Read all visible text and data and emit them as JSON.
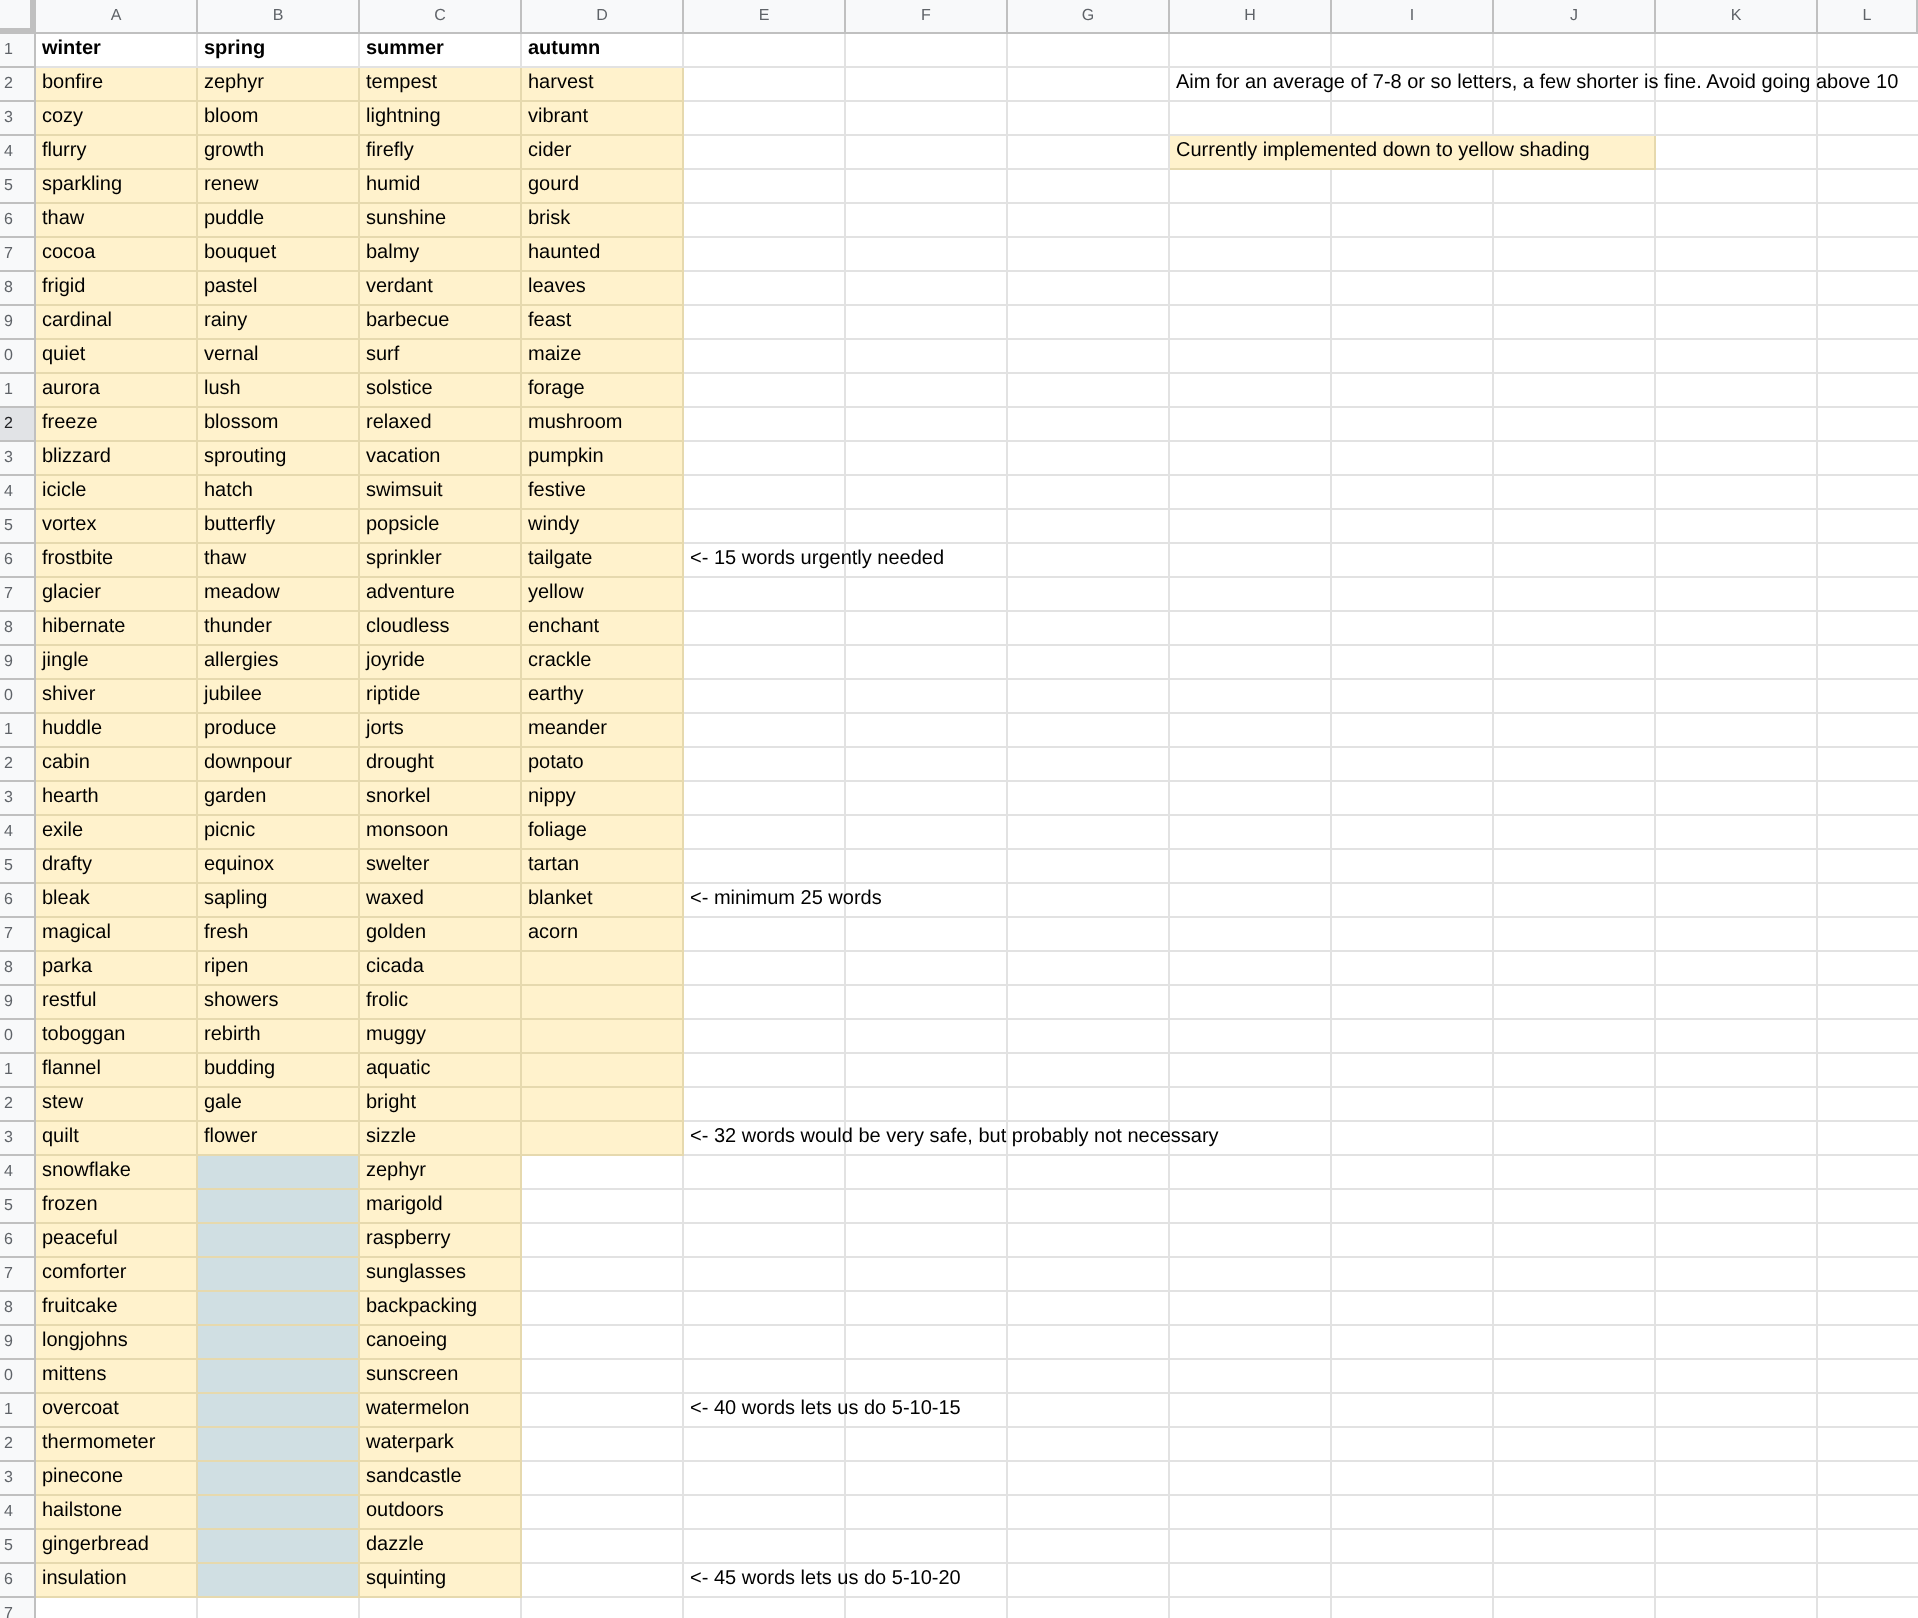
{
  "columns": [
    "A",
    "B",
    "C",
    "D",
    "E",
    "F",
    "G",
    "H",
    "I",
    "J",
    "K",
    "L"
  ],
  "rows": [
    {
      "number": "1",
      "selected": false,
      "kind": "heading",
      "cells": [
        {
          "text": "winter"
        },
        {
          "text": "spring"
        },
        {
          "text": "summer"
        },
        {
          "text": "autumn"
        }
      ]
    },
    {
      "number": "2",
      "selected": false,
      "kind": "words",
      "cells": [
        {
          "text": "bonfire",
          "color": "#fff2cc"
        },
        {
          "text": "zephyr",
          "color": "#fff2cc"
        },
        {
          "text": "tempest",
          "color": "#fff2cc"
        },
        {
          "text": "harvest",
          "color": "#fff2cc"
        }
      ],
      "side_note": {
        "text": "Aim for an average of 7-8 or so letters, a few shorter is fine. Avoid going above 10"
      }
    },
    {
      "number": "3",
      "selected": false,
      "kind": "words",
      "cells": [
        {
          "text": "cozy",
          "color": "#fff2cc"
        },
        {
          "text": "bloom",
          "color": "#fff2cc"
        },
        {
          "text": "lightning",
          "color": "#fff2cc"
        },
        {
          "text": "vibrant",
          "color": "#fff2cc"
        }
      ]
    },
    {
      "number": "4",
      "selected": false,
      "kind": "words",
      "cells": [
        {
          "text": "flurry",
          "color": "#fff2cc"
        },
        {
          "text": "growth",
          "color": "#fff2cc"
        },
        {
          "text": "firefly",
          "color": "#fff2cc"
        },
        {
          "text": "cider",
          "color": "#fff2cc"
        }
      ],
      "side_note": {
        "text": "Currently implemented down to yellow shading",
        "color": "#fff2cc"
      }
    },
    {
      "number": "5",
      "selected": false,
      "kind": "words",
      "cells": [
        {
          "text": "sparkling",
          "color": "#fff2cc"
        },
        {
          "text": "renew",
          "color": "#fff2cc"
        },
        {
          "text": "humid",
          "color": "#fff2cc"
        },
        {
          "text": "gourd",
          "color": "#fff2cc"
        }
      ]
    },
    {
      "number": "6",
      "selected": false,
      "kind": "words",
      "cells": [
        {
          "text": "thaw",
          "color": "#fff2cc"
        },
        {
          "text": "puddle",
          "color": "#fff2cc"
        },
        {
          "text": "sunshine",
          "color": "#fff2cc"
        },
        {
          "text": "brisk",
          "color": "#fff2cc"
        }
      ]
    },
    {
      "number": "7",
      "selected": false,
      "kind": "words",
      "cells": [
        {
          "text": "cocoa",
          "color": "#fff2cc"
        },
        {
          "text": "bouquet",
          "color": "#fff2cc"
        },
        {
          "text": "balmy",
          "color": "#fff2cc"
        },
        {
          "text": "haunted",
          "color": "#fff2cc"
        }
      ]
    },
    {
      "number": "8",
      "selected": false,
      "kind": "words",
      "cells": [
        {
          "text": "frigid",
          "color": "#fff2cc"
        },
        {
          "text": "pastel",
          "color": "#fff2cc"
        },
        {
          "text": "verdant",
          "color": "#fff2cc"
        },
        {
          "text": "leaves",
          "color": "#fff2cc"
        }
      ]
    },
    {
      "number": "9",
      "selected": false,
      "kind": "words",
      "cells": [
        {
          "text": "cardinal",
          "color": "#fff2cc"
        },
        {
          "text": "rainy",
          "color": "#fff2cc"
        },
        {
          "text": "barbecue",
          "color": "#fff2cc"
        },
        {
          "text": "feast",
          "color": "#fff2cc"
        }
      ]
    },
    {
      "number": "0",
      "selected": false,
      "kind": "words",
      "cells": [
        {
          "text": "quiet",
          "color": "#fff2cc"
        },
        {
          "text": "vernal",
          "color": "#fff2cc"
        },
        {
          "text": "surf",
          "color": "#fff2cc"
        },
        {
          "text": "maize",
          "color": "#fff2cc"
        }
      ]
    },
    {
      "number": "1",
      "selected": false,
      "kind": "words",
      "cells": [
        {
          "text": "aurora",
          "color": "#fff2cc"
        },
        {
          "text": "lush",
          "color": "#fff2cc"
        },
        {
          "text": "solstice",
          "color": "#fff2cc"
        },
        {
          "text": "forage",
          "color": "#fff2cc"
        }
      ]
    },
    {
      "number": "2",
      "selected": true,
      "kind": "words",
      "cells": [
        {
          "text": "freeze",
          "color": "#fff2cc"
        },
        {
          "text": "blossom",
          "color": "#fff2cc"
        },
        {
          "text": "relaxed",
          "color": "#fff2cc"
        },
        {
          "text": "mushroom",
          "color": "#fff2cc"
        }
      ]
    },
    {
      "number": "3",
      "selected": false,
      "kind": "words",
      "cells": [
        {
          "text": "blizzard",
          "color": "#fff2cc"
        },
        {
          "text": "sprouting",
          "color": "#fff2cc"
        },
        {
          "text": "vacation",
          "color": "#fff2cc"
        },
        {
          "text": "pumpkin",
          "color": "#fff2cc"
        }
      ]
    },
    {
      "number": "4",
      "selected": false,
      "kind": "words",
      "cells": [
        {
          "text": "icicle",
          "color": "#fff2cc"
        },
        {
          "text": "hatch",
          "color": "#fff2cc"
        },
        {
          "text": "swimsuit",
          "color": "#fff2cc"
        },
        {
          "text": "festive",
          "color": "#fff2cc"
        }
      ]
    },
    {
      "number": "5",
      "selected": false,
      "kind": "words",
      "cells": [
        {
          "text": "vortex",
          "color": "#fff2cc"
        },
        {
          "text": "butterfly",
          "color": "#fff2cc"
        },
        {
          "text": "popsicle",
          "color": "#fff2cc"
        },
        {
          "text": "windy",
          "color": "#fff2cc"
        }
      ]
    },
    {
      "number": "6",
      "selected": false,
      "kind": "words",
      "cells": [
        {
          "text": "frostbite",
          "color": "#fff2cc"
        },
        {
          "text": "thaw",
          "color": "#fff2cc"
        },
        {
          "text": "sprinkler",
          "color": "#fff2cc"
        },
        {
          "text": "tailgate",
          "color": "#fff2cc"
        }
      ],
      "note": "<- 15 words urgently needed"
    },
    {
      "number": "7",
      "selected": false,
      "kind": "words",
      "cells": [
        {
          "text": "glacier",
          "color": "#fff2cc"
        },
        {
          "text": "meadow",
          "color": "#fff2cc"
        },
        {
          "text": "adventure",
          "color": "#fff2cc"
        },
        {
          "text": "yellow",
          "color": "#fff2cc"
        }
      ]
    },
    {
      "number": "8",
      "selected": false,
      "kind": "words",
      "cells": [
        {
          "text": "hibernate",
          "color": "#fff2cc"
        },
        {
          "text": "thunder",
          "color": "#fff2cc"
        },
        {
          "text": "cloudless",
          "color": "#fff2cc"
        },
        {
          "text": "enchant",
          "color": "#fff2cc"
        }
      ]
    },
    {
      "number": "9",
      "selected": false,
      "kind": "words",
      "cells": [
        {
          "text": "jingle",
          "color": "#fff2cc"
        },
        {
          "text": "allergies",
          "color": "#fff2cc"
        },
        {
          "text": "joyride",
          "color": "#fff2cc"
        },
        {
          "text": "crackle",
          "color": "#fff2cc"
        }
      ]
    },
    {
      "number": "0",
      "selected": false,
      "kind": "words",
      "cells": [
        {
          "text": "shiver",
          "color": "#fff2cc"
        },
        {
          "text": "jubilee",
          "color": "#fff2cc"
        },
        {
          "text": "riptide",
          "color": "#fff2cc"
        },
        {
          "text": "earthy",
          "color": "#fff2cc"
        }
      ]
    },
    {
      "number": "1",
      "selected": false,
      "kind": "words",
      "cells": [
        {
          "text": "huddle",
          "color": "#fff2cc"
        },
        {
          "text": "produce",
          "color": "#fff2cc"
        },
        {
          "text": "jorts",
          "color": "#fff2cc"
        },
        {
          "text": "meander",
          "color": "#fff2cc"
        }
      ]
    },
    {
      "number": "2",
      "selected": false,
      "kind": "words",
      "cells": [
        {
          "text": "cabin",
          "color": "#fff2cc"
        },
        {
          "text": "downpour",
          "color": "#fff2cc"
        },
        {
          "text": "drought",
          "color": "#fff2cc"
        },
        {
          "text": "potato",
          "color": "#fff2cc"
        }
      ]
    },
    {
      "number": "3",
      "selected": false,
      "kind": "words",
      "cells": [
        {
          "text": "hearth",
          "color": "#fff2cc"
        },
        {
          "text": "garden",
          "color": "#fff2cc"
        },
        {
          "text": "snorkel",
          "color": "#fff2cc"
        },
        {
          "text": "nippy",
          "color": "#fff2cc"
        }
      ]
    },
    {
      "number": "4",
      "selected": false,
      "kind": "words",
      "cells": [
        {
          "text": "exile",
          "color": "#fff2cc"
        },
        {
          "text": "picnic",
          "color": "#fff2cc"
        },
        {
          "text": "monsoon",
          "color": "#fff2cc"
        },
        {
          "text": "foliage",
          "color": "#fff2cc"
        }
      ]
    },
    {
      "number": "5",
      "selected": false,
      "kind": "words",
      "cells": [
        {
          "text": "drafty",
          "color": "#fff2cc"
        },
        {
          "text": "equinox",
          "color": "#fff2cc"
        },
        {
          "text": "swelter",
          "color": "#fff2cc"
        },
        {
          "text": "tartan",
          "color": "#fff2cc"
        }
      ]
    },
    {
      "number": "6",
      "selected": false,
      "kind": "words",
      "cells": [
        {
          "text": "bleak",
          "color": "#fff2cc"
        },
        {
          "text": "sapling",
          "color": "#fff2cc"
        },
        {
          "text": "waxed",
          "color": "#fff2cc"
        },
        {
          "text": "blanket",
          "color": "#fff2cc"
        }
      ],
      "note": "<- minimum 25 words"
    },
    {
      "number": "7",
      "selected": false,
      "kind": "words",
      "cells": [
        {
          "text": "magical",
          "color": "#fff2cc"
        },
        {
          "text": "fresh",
          "color": "#fff2cc"
        },
        {
          "text": "golden",
          "color": "#fff2cc"
        },
        {
          "text": "acorn",
          "color": "#fff2cc"
        }
      ]
    },
    {
      "number": "8",
      "selected": false,
      "kind": "words",
      "cells": [
        {
          "text": "parka",
          "color": "#fff2cc"
        },
        {
          "text": "ripen",
          "color": "#fff2cc"
        },
        {
          "text": "cicada",
          "color": "#fff2cc"
        },
        {
          "color": "#fff2cc"
        }
      ]
    },
    {
      "number": "9",
      "selected": false,
      "kind": "words",
      "cells": [
        {
          "text": "restful",
          "color": "#fff2cc"
        },
        {
          "text": "showers",
          "color": "#fff2cc"
        },
        {
          "text": "frolic",
          "color": "#fff2cc"
        },
        {
          "color": "#fff2cc"
        }
      ]
    },
    {
      "number": "0",
      "selected": false,
      "kind": "words",
      "cells": [
        {
          "text": "toboggan",
          "color": "#fff2cc"
        },
        {
          "text": "rebirth",
          "color": "#fff2cc"
        },
        {
          "text": "muggy",
          "color": "#fff2cc"
        },
        {
          "color": "#fff2cc"
        }
      ]
    },
    {
      "number": "1",
      "selected": false,
      "kind": "words",
      "cells": [
        {
          "text": "flannel",
          "color": "#fff2cc"
        },
        {
          "text": "budding",
          "color": "#fff2cc"
        },
        {
          "text": "aquatic",
          "color": "#fff2cc"
        },
        {
          "color": "#fff2cc"
        }
      ]
    },
    {
      "number": "2",
      "selected": false,
      "kind": "words",
      "cells": [
        {
          "text": "stew",
          "color": "#fff2cc"
        },
        {
          "text": "gale",
          "color": "#fff2cc"
        },
        {
          "text": "bright",
          "color": "#fff2cc"
        },
        {
          "color": "#fff2cc"
        }
      ]
    },
    {
      "number": "3",
      "selected": false,
      "kind": "words",
      "cells": [
        {
          "text": "quilt",
          "color": "#fff2cc"
        },
        {
          "text": "flower",
          "color": "#fff2cc"
        },
        {
          "text": "sizzle",
          "color": "#fff2cc"
        },
        {
          "color": "#fff2cc"
        }
      ],
      "note": "<- 32 words would be very safe, but probably not necessary"
    },
    {
      "number": "4",
      "selected": false,
      "kind": "words",
      "cells": [
        {
          "text": "snowflake",
          "color": "#fff2cc"
        },
        {
          "color": "#d0dfe3"
        },
        {
          "text": "zephyr",
          "color": "#fff2cc"
        }
      ]
    },
    {
      "number": "5",
      "selected": false,
      "kind": "words",
      "cells": [
        {
          "text": "frozen",
          "color": "#fff2cc"
        },
        {
          "color": "#d0dfe3"
        },
        {
          "text": "marigold",
          "color": "#fff2cc"
        }
      ]
    },
    {
      "number": "6",
      "selected": false,
      "kind": "words",
      "cells": [
        {
          "text": "peaceful",
          "color": "#fff2cc"
        },
        {
          "color": "#d0dfe3"
        },
        {
          "text": "raspberry",
          "color": "#fff2cc"
        }
      ]
    },
    {
      "number": "7",
      "selected": false,
      "kind": "words",
      "cells": [
        {
          "text": "comforter",
          "color": "#fff2cc"
        },
        {
          "color": "#d0dfe3"
        },
        {
          "text": "sunglasses",
          "color": "#fff2cc"
        }
      ]
    },
    {
      "number": "8",
      "selected": false,
      "kind": "words",
      "cells": [
        {
          "text": "fruitcake",
          "color": "#fff2cc"
        },
        {
          "color": "#d0dfe3"
        },
        {
          "text": "backpacking",
          "color": "#fff2cc"
        }
      ]
    },
    {
      "number": "9",
      "selected": false,
      "kind": "words",
      "cells": [
        {
          "text": "longjohns",
          "color": "#fff2cc"
        },
        {
          "color": "#d0dfe3"
        },
        {
          "text": "canoeing",
          "color": "#fff2cc"
        }
      ]
    },
    {
      "number": "0",
      "selected": false,
      "kind": "words",
      "cells": [
        {
          "text": "mittens",
          "color": "#fff2cc"
        },
        {
          "color": "#d0dfe3"
        },
        {
          "text": "sunscreen",
          "color": "#fff2cc"
        }
      ]
    },
    {
      "number": "1",
      "selected": false,
      "kind": "words",
      "cells": [
        {
          "text": "overcoat",
          "color": "#fff2cc"
        },
        {
          "color": "#d0dfe3"
        },
        {
          "text": "watermelon",
          "color": "#fff2cc"
        }
      ],
      "note": "<- 40 words lets us do 5-10-15"
    },
    {
      "number": "2",
      "selected": false,
      "kind": "words",
      "cells": [
        {
          "text": "thermometer",
          "color": "#fff2cc"
        },
        {
          "color": "#d0dfe3"
        },
        {
          "text": "waterpark",
          "color": "#fff2cc"
        }
      ]
    },
    {
      "number": "3",
      "selected": false,
      "kind": "words",
      "cells": [
        {
          "text": "pinecone",
          "color": "#fff2cc"
        },
        {
          "color": "#d0dfe3"
        },
        {
          "text": "sandcastle",
          "color": "#fff2cc"
        }
      ]
    },
    {
      "number": "4",
      "selected": false,
      "kind": "words",
      "cells": [
        {
          "text": "hailstone",
          "color": "#fff2cc"
        },
        {
          "color": "#d0dfe3"
        },
        {
          "text": "outdoors",
          "color": "#fff2cc"
        }
      ]
    },
    {
      "number": "5",
      "selected": false,
      "kind": "words",
      "cells": [
        {
          "text": "gingerbread",
          "color": "#fff2cc"
        },
        {
          "color": "#d0dfe3"
        },
        {
          "text": "dazzle",
          "color": "#fff2cc"
        }
      ]
    },
    {
      "number": "6",
      "selected": false,
      "kind": "words",
      "cells": [
        {
          "text": "insulation",
          "color": "#fff2cc"
        },
        {
          "color": "#d0dfe3"
        },
        {
          "text": "squinting",
          "color": "#fff2cc"
        }
      ],
      "note": "<- 45 words lets us do 5-10-20"
    },
    {
      "number": "7",
      "selected": false,
      "kind": "words"
    }
  ]
}
